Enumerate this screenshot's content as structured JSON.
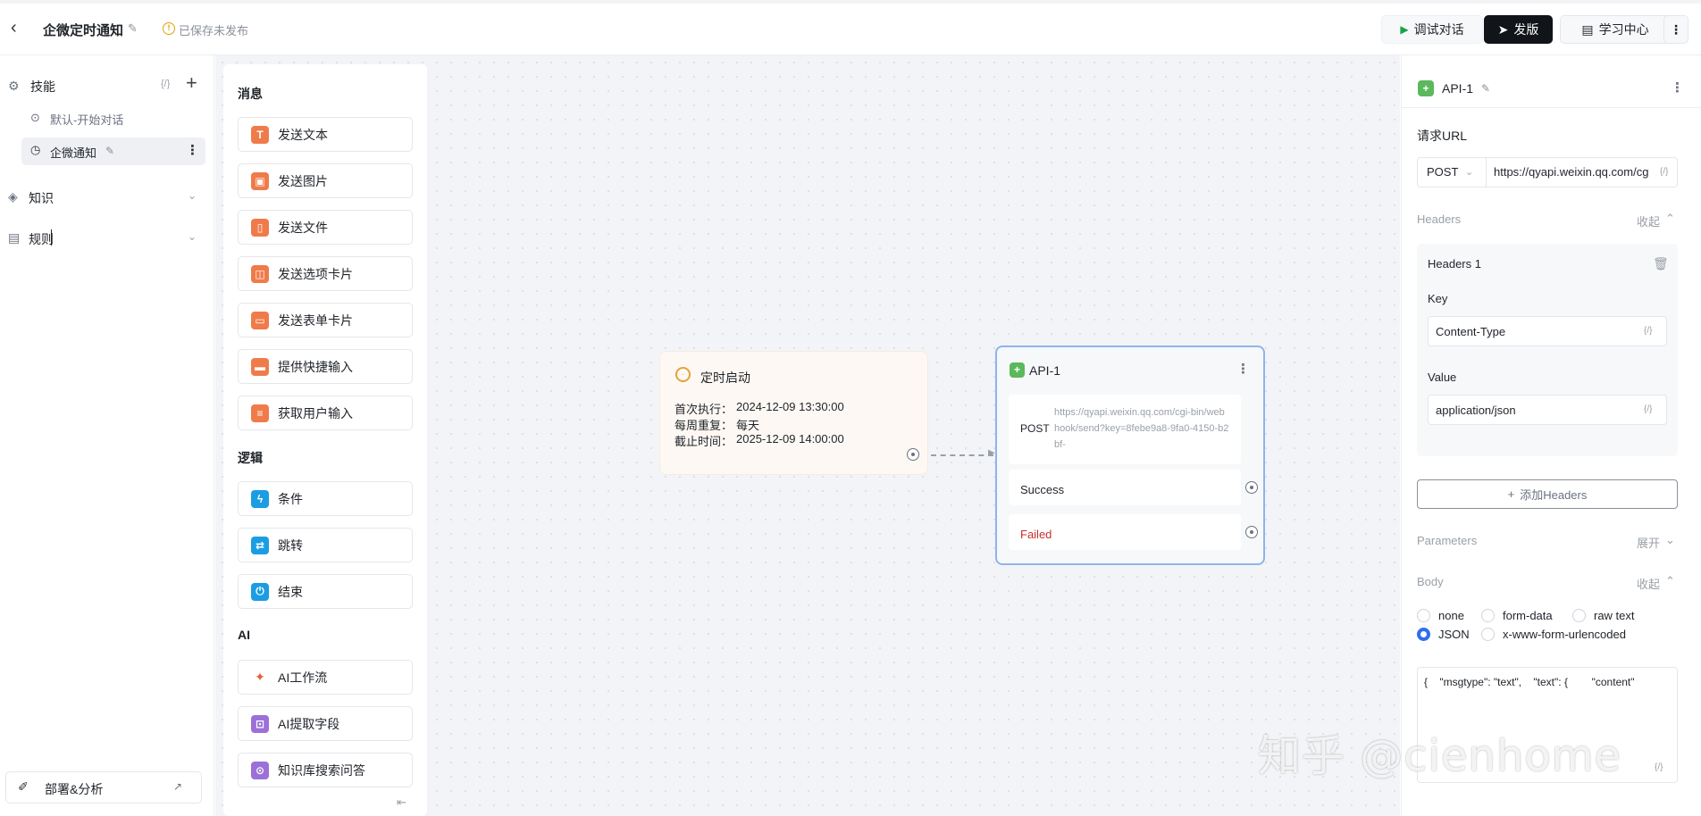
{
  "header": {
    "back_icon": "chevron-left-icon",
    "title": "企微定时通知",
    "save_status": "已保存未发布",
    "debug_label": "调试对话",
    "publish_label": "发版",
    "learn_label": "学习中心",
    "more_label": "⋮"
  },
  "sidebar": {
    "skills_label": "技能",
    "skills_var": "{/}",
    "skill_items": [
      "默认-开始对话",
      "企微通知"
    ],
    "knowledge_label": "知识",
    "rules_label": "规则",
    "deploy_label": "部署&分析"
  },
  "palette": {
    "sections": [
      {
        "title": "消息",
        "items": [
          "发送文本",
          "发送图片",
          "发送文件",
          "发送选项卡片",
          "发送表单卡片",
          "提供快捷输入",
          "获取用户输入"
        ]
      },
      {
        "title": "逻辑",
        "items": [
          "条件",
          "跳转",
          "结束"
        ]
      },
      {
        "title": "AI",
        "items": [
          "AI工作流",
          "AI提取字段",
          "知识库搜索问答"
        ]
      }
    ]
  },
  "timer_node": {
    "title": "定时启动",
    "lines": [
      {
        "label": "首次执行：",
        "value": "2024-12-09 13:30:00"
      },
      {
        "label": "每周重复：",
        "value": "每天"
      },
      {
        "label": "截止时间：",
        "value": "2025-12-09 14:00:00"
      }
    ]
  },
  "api_node": {
    "title": "API-1",
    "method": "POST",
    "url": "https://qyapi.weixin.qq.com/cgi-bin/webhook/send?key=8febe9a8-9fa0-4150-b2bf-",
    "success_label": "Success",
    "failed_label": "Failed"
  },
  "panel": {
    "title": "API-1",
    "request_url_label": "请求URL",
    "method": "POST",
    "url_value": "https://qyapi.weixin.qq.com/cg",
    "var_icon": "{/}",
    "headers_label": "Headers",
    "headers_toggle": "收起",
    "header_card_title": "Headers 1",
    "key_label": "Key",
    "key_value": "Content-Type",
    "value_label": "Value",
    "value_value": "application/json",
    "add_headers_label": "添加Headers",
    "parameters_label": "Parameters",
    "parameters_toggle": "展开",
    "body_label": "Body",
    "body_toggle": "收起",
    "body_types": [
      "none",
      "form-data",
      "raw text",
      "JSON",
      "x-www-form-urlencoded"
    ],
    "body_selected": "JSON",
    "body_content": "{    \"msgtype\": \"text\",    \"text\": {        \"content\"",
    "watermark": "知乎 @cienhome"
  }
}
